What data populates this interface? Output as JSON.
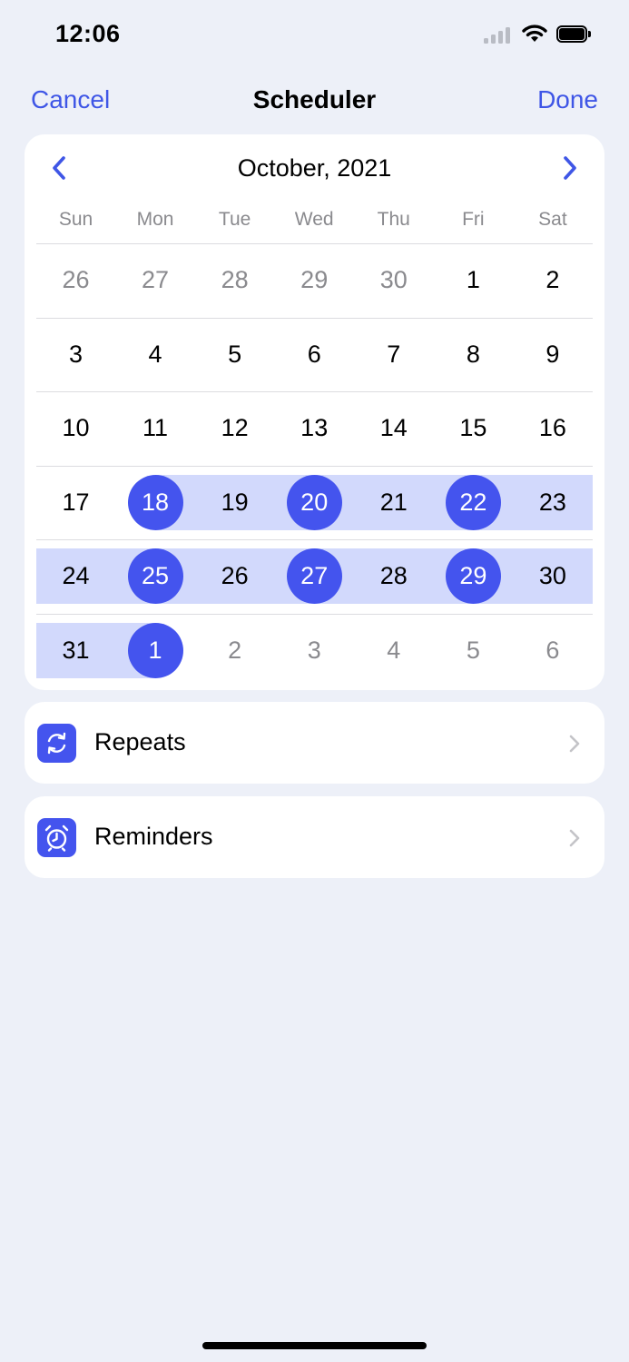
{
  "status_bar": {
    "time": "12:06"
  },
  "nav": {
    "cancel": "Cancel",
    "title": "Scheduler",
    "done": "Done"
  },
  "calendar": {
    "month_label": "October, 2021",
    "weekdays": [
      "Sun",
      "Mon",
      "Tue",
      "Wed",
      "Thu",
      "Fri",
      "Sat"
    ],
    "weeks": [
      [
        "26",
        "27",
        "28",
        "29",
        "30",
        "1",
        "2"
      ],
      [
        "3",
        "4",
        "5",
        "6",
        "7",
        "8",
        "9"
      ],
      [
        "10",
        "11",
        "12",
        "13",
        "14",
        "15",
        "16"
      ],
      [
        "17",
        "18",
        "19",
        "20",
        "21",
        "22",
        "23"
      ],
      [
        "24",
        "25",
        "26",
        "27",
        "28",
        "29",
        "30"
      ],
      [
        "31",
        "1",
        "2",
        "3",
        "4",
        "5",
        "6"
      ]
    ],
    "muted": [
      [
        0,
        0
      ],
      [
        0,
        1
      ],
      [
        0,
        2
      ],
      [
        0,
        3
      ],
      [
        0,
        4
      ],
      [
        5,
        2
      ],
      [
        5,
        3
      ],
      [
        5,
        4
      ],
      [
        5,
        5
      ],
      [
        5,
        6
      ]
    ],
    "selected": [
      [
        3,
        1
      ],
      [
        3,
        3
      ],
      [
        3,
        5
      ],
      [
        4,
        1
      ],
      [
        4,
        3
      ],
      [
        4,
        5
      ],
      [
        5,
        1
      ]
    ],
    "range_rows": [
      {
        "row": 3,
        "from": 1,
        "to": 6
      },
      {
        "row": 4,
        "from": 0,
        "to": 6
      },
      {
        "row": 5,
        "from": 0,
        "to": 1
      }
    ]
  },
  "options": {
    "repeats": {
      "label": "Repeats",
      "icon": "repeat-icon"
    },
    "reminders": {
      "label": "Reminders",
      "icon": "alarm-clock-icon"
    }
  },
  "colors": {
    "accent": "#4454EE",
    "link": "#3F56E6",
    "range_highlight": "#D2D9FC",
    "background": "#EDF0F8"
  }
}
